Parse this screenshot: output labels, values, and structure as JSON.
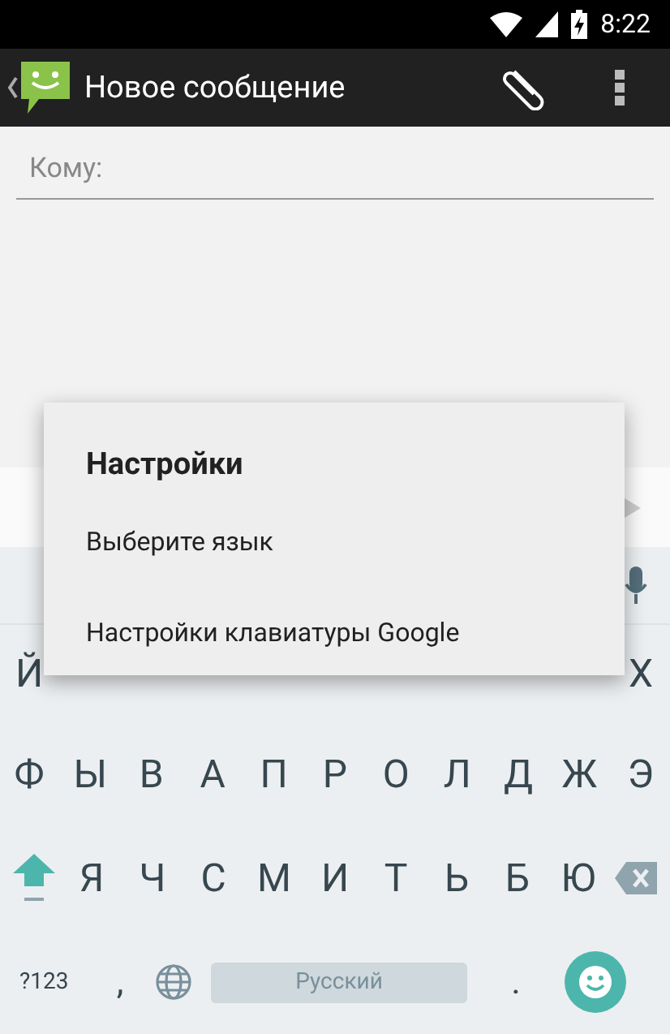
{
  "status_bar": {
    "time": "8:22"
  },
  "action_bar": {
    "title": "Новое сообщение"
  },
  "recipient_field": {
    "placeholder": "Кому:"
  },
  "keyboard": {
    "row_1": [
      "Й",
      "Х"
    ],
    "row_2": [
      "Ф",
      "Ы",
      "В",
      "А",
      "П",
      "Р",
      "О",
      "Л",
      "Д",
      "Ж",
      "Э"
    ],
    "row_3": [
      "Я",
      "Ч",
      "С",
      "М",
      "И",
      "Т",
      "Ь",
      "Б",
      "Ю"
    ],
    "symbols_key": "?123",
    "comma_key": ",",
    "space_key": "Русский",
    "period_key": "."
  },
  "dialog": {
    "title": "Настройки",
    "items": [
      "Выберите язык",
      "Настройки клавиатуры Google"
    ]
  }
}
